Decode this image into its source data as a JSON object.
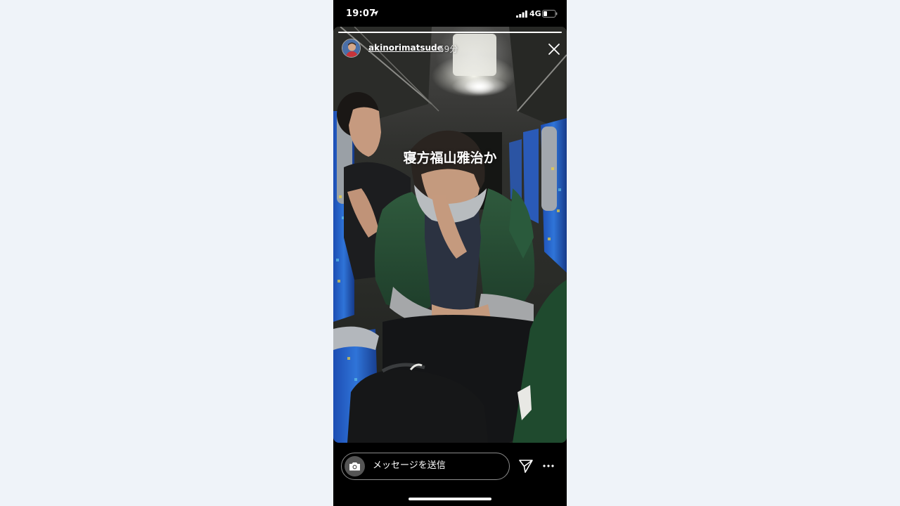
{
  "status_bar": {
    "time": "19:07",
    "network": "4G",
    "icons": [
      "location-arrow-icon",
      "signal-bars-icon",
      "battery-icon"
    ]
  },
  "story": {
    "progress": 1.0,
    "username": "akinorimatsude",
    "time_ago": "59分",
    "caption": "寝方福山雅治か",
    "icons": [
      "avatar",
      "close-icon"
    ]
  },
  "footer": {
    "message_placeholder": "メッセージを送信",
    "icons": [
      "camera-icon",
      "send-icon",
      "more-icon"
    ]
  },
  "colors": {
    "background": "#eff3f9",
    "phone": "#000000",
    "text": "#ffffff"
  }
}
